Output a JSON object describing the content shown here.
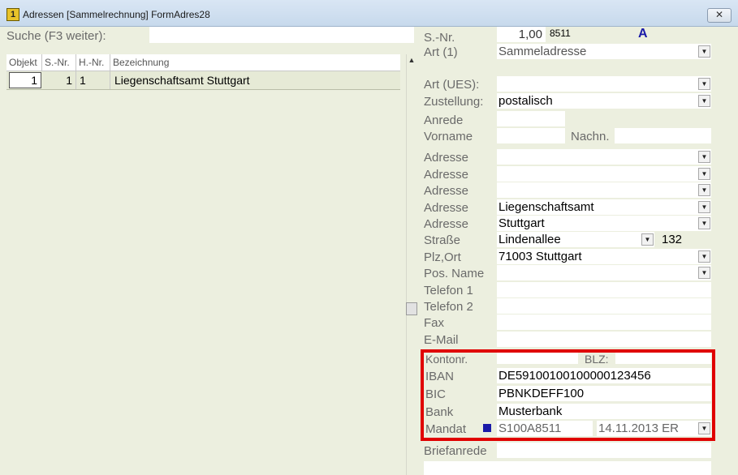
{
  "window": {
    "title": "Adressen [Sammelrechnung] FormAdres28",
    "close_label": "✕"
  },
  "search": {
    "label": "Suche (F3 weiter):",
    "value": ""
  },
  "grid": {
    "columns": [
      "Objekt",
      "S.-Nr.",
      "H.-Nr.",
      "Bezeichnung"
    ],
    "rows": [
      {
        "objekt": "1",
        "snr": "1",
        "hnr": "1",
        "bezeichnung": "Liegenschaftsamt Stuttgart"
      }
    ]
  },
  "form": {
    "snr_label": "S.-Nr.",
    "snr_value": "1,00",
    "snr_code": "8511",
    "snr_flag": "A",
    "art1_label": "Art (1)",
    "art1_value": "Sammeladresse",
    "artues_label": "Art (UES):",
    "artues_value": "",
    "zustellung_label": "Zustellung:",
    "zustellung_value": "postalisch",
    "anrede_label": "Anrede",
    "anrede_value": "",
    "vorname_label": "Vorname",
    "vorname_value": "",
    "nachn_label": "Nachn.",
    "nachn_value": "",
    "adresse_label": "Adresse",
    "adresse_values": [
      "",
      "",
      "",
      "Liegenschaftsamt",
      "Stuttgart"
    ],
    "strasse_label": "Straße",
    "strasse_value": "Lindenallee",
    "hausnr_value": "132",
    "plzort_label": "Plz,Ort",
    "plzort_value": "71003 Stuttgart",
    "posname_label": "Pos. Name",
    "posname_value": "",
    "telefon1_label": "Telefon 1",
    "telefon1_value": "",
    "telefon2_label": "Telefon 2",
    "telefon2_value": "",
    "fax_label": "Fax",
    "fax_value": "",
    "email_label": "E-Mail",
    "email_value": "",
    "kontonr_label": "Kontonr.",
    "kontonr_value": "",
    "blz_label": "BLZ:",
    "blz_value": "",
    "iban_label": "IBAN",
    "iban_value": "DE59100100100000123456",
    "bic_label": "BIC",
    "bic_value": "PBNKDEFF100",
    "bank_label": "Bank",
    "bank_value": "Musterbank",
    "mandat_label": "Mandat",
    "mandat_id": "S100A8511",
    "mandat_date": "14.11.2013",
    "mandat_code": "ER",
    "briefanrede_label": "Briefanrede",
    "briefanrede_value": ""
  },
  "colors": {
    "highlight_border": "#e00000",
    "background": "#ecefdf",
    "mandat_marker": "#1a1aa8",
    "flag_color": "#1a1aa8"
  },
  "icons": {
    "dropdown": "chevron-down-icon",
    "title": "app-icon",
    "scroll_up": "arrow-up-icon"
  }
}
